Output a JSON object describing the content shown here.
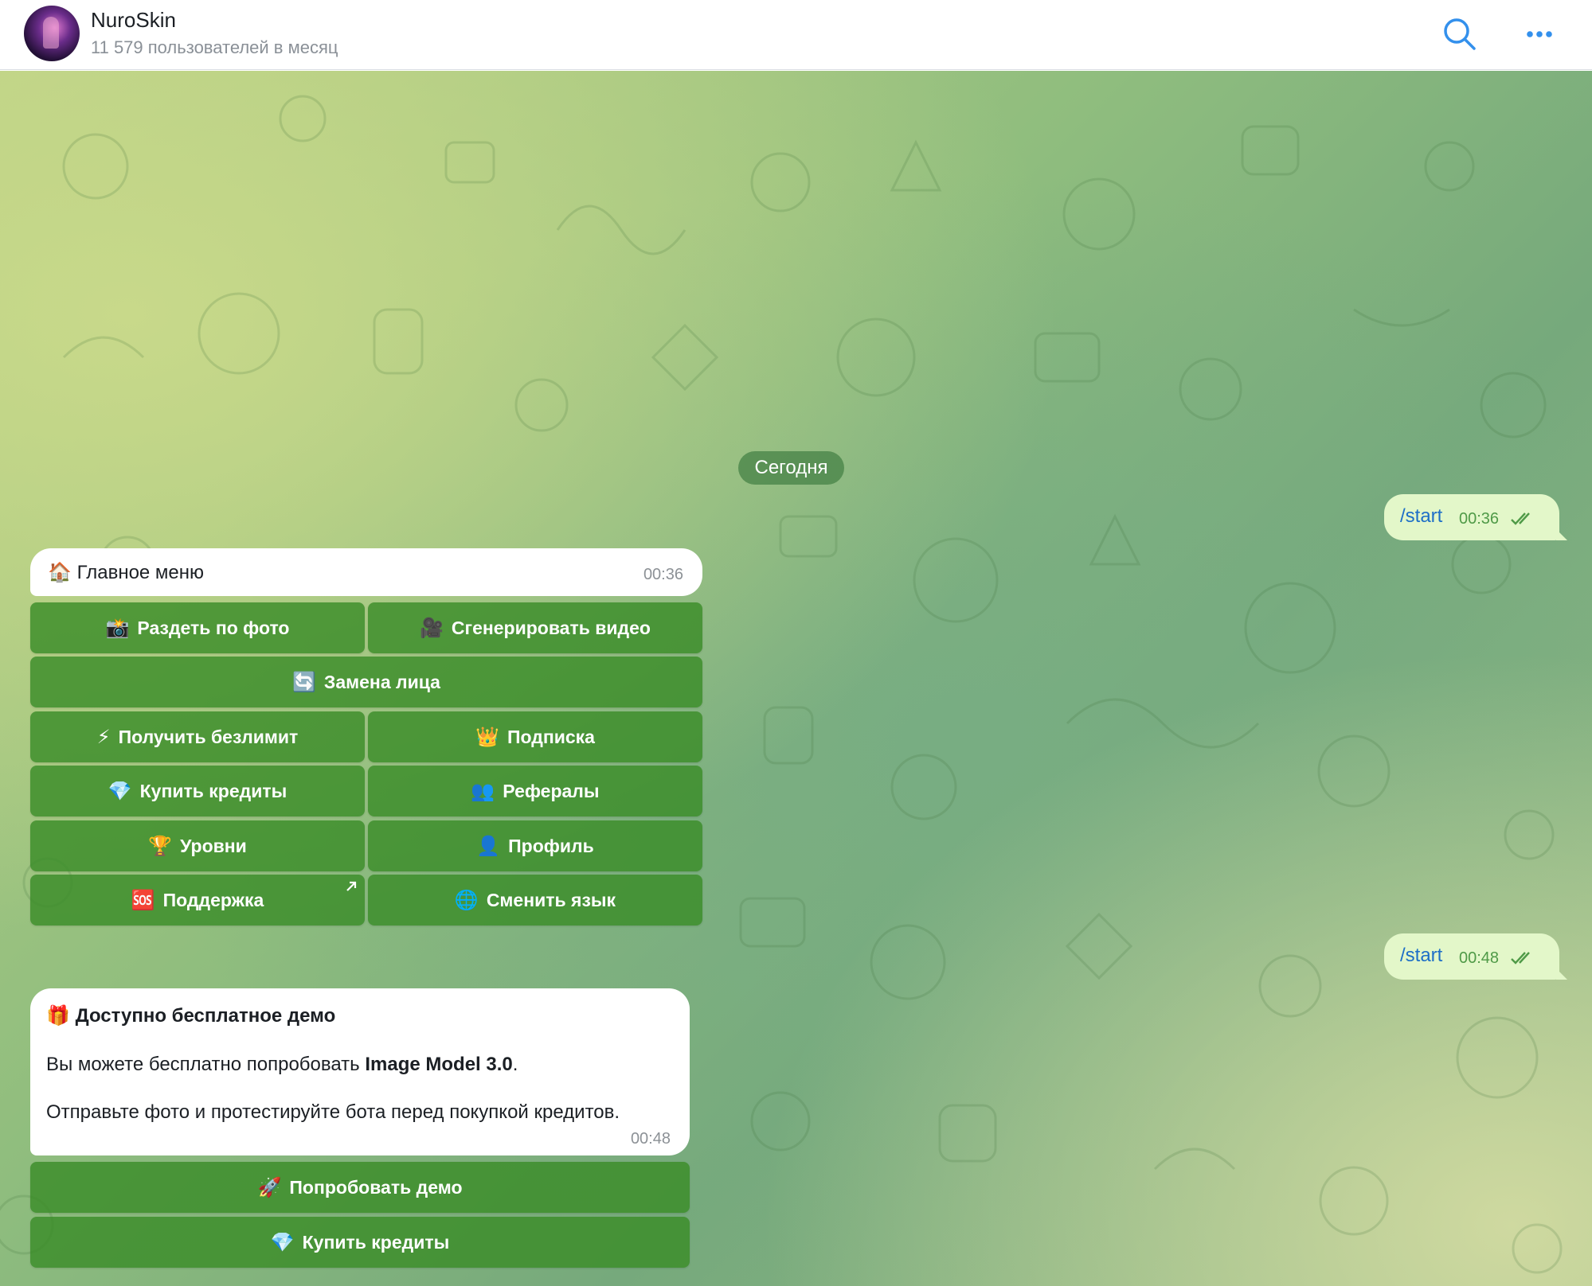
{
  "header": {
    "title": "NuroSkin",
    "subtitle": "11 579 пользователей в месяц",
    "search_icon": "search-icon",
    "more_icon": "more-horizontal-icon",
    "accent_color": "#3390ec"
  },
  "chat": {
    "date_chip": "Сегодня",
    "outgoing": [
      {
        "text": "/start",
        "time": "00:36",
        "status": "read"
      },
      {
        "text": "/start",
        "time": "00:48",
        "status": "read"
      }
    ],
    "menu_message": {
      "emoji": "🏠",
      "text": "Главное меню",
      "time": "00:36"
    },
    "menu_keyboard": [
      {
        "emoji": "📸",
        "label": "Раздеть по фото"
      },
      {
        "emoji": "🎥",
        "label": "Сгенерировать видео"
      },
      {
        "emoji": "🔄",
        "label": "Замена лица"
      },
      {
        "emoji": "⚡",
        "label": "Получить безлимит"
      },
      {
        "emoji": "👑",
        "label": "Подписка"
      },
      {
        "emoji": "💎",
        "label": "Купить кредиты"
      },
      {
        "emoji": "👥",
        "label": "Рефералы"
      },
      {
        "emoji": "🏆",
        "label": "Уровни"
      },
      {
        "emoji": "👤",
        "label": "Профиль"
      },
      {
        "emoji": "🆘",
        "label": "Поддержка"
      },
      {
        "emoji": "🌐",
        "label": "Сменить язык"
      }
    ],
    "demo_message": {
      "emoji": "🎁",
      "title": "Доступно бесплатное демо",
      "line1_prefix": "Вы можете бесплатно попробовать ",
      "line1_bold": "Image Model 3.0",
      "line1_suffix": ".",
      "line2": "Отправьте фото и протестируйте бота перед покупкой кредитов.",
      "time": "00:48"
    },
    "demo_keyboard": [
      {
        "emoji": "🚀",
        "label": "Попробовать демо"
      },
      {
        "emoji": "💎",
        "label": "Купить кредиты"
      }
    ]
  }
}
